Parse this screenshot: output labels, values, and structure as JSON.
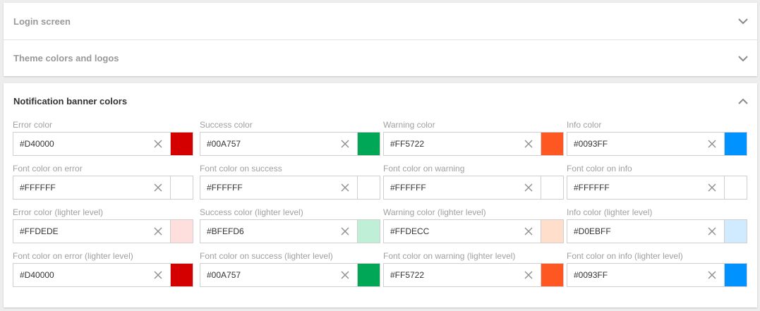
{
  "sections": {
    "login": {
      "title": "Login screen"
    },
    "theme": {
      "title": "Theme colors and logos"
    },
    "notification": {
      "title": "Notification banner colors"
    }
  },
  "fields": [
    [
      {
        "label": "Error color",
        "value": "#D40000",
        "swatch": "#D40000"
      },
      {
        "label": "Success color",
        "value": "#00A757",
        "swatch": "#00A757"
      },
      {
        "label": "Warning color",
        "value": "#FF5722",
        "swatch": "#FF5722"
      },
      {
        "label": "Info color",
        "value": "#0093FF",
        "swatch": "#0093FF"
      }
    ],
    [
      {
        "label": "Font color on error",
        "value": "#FFFFFF",
        "swatch": "#FFFFFF"
      },
      {
        "label": "Font color on success",
        "value": "#FFFFFF",
        "swatch": "#FFFFFF"
      },
      {
        "label": "Font color on warning",
        "value": "#FFFFFF",
        "swatch": "#FFFFFF"
      },
      {
        "label": "Font color on info",
        "value": "#FFFFFF",
        "swatch": "#FFFFFF"
      }
    ],
    [
      {
        "label": "Error color (lighter level)",
        "value": "#FFDEDE",
        "swatch": "#FFDEDE"
      },
      {
        "label": "Success color (lighter level)",
        "value": "#BFEFD6",
        "swatch": "#BFEFD6"
      },
      {
        "label": "Warning color (lighter level)",
        "value": "#FFDECC",
        "swatch": "#FFDECC"
      },
      {
        "label": "Info color (lighter level)",
        "value": "#D0EBFF",
        "swatch": "#D0EBFF"
      }
    ],
    [
      {
        "label": "Font color on error (lighter level)",
        "value": "#D40000",
        "swatch": "#D40000"
      },
      {
        "label": "Font color on success (lighter level)",
        "value": "#00A757",
        "swatch": "#00A757"
      },
      {
        "label": "Font color on warning (lighter level)",
        "value": "#FF5722",
        "swatch": "#FF5722"
      },
      {
        "label": "Font color on info (lighter level)",
        "value": "#0093FF",
        "swatch": "#0093FF"
      }
    ]
  ],
  "icons": {
    "collapsed": "chevron-down-icon",
    "expanded": "chevron-up-icon",
    "clear": "clear-icon"
  }
}
